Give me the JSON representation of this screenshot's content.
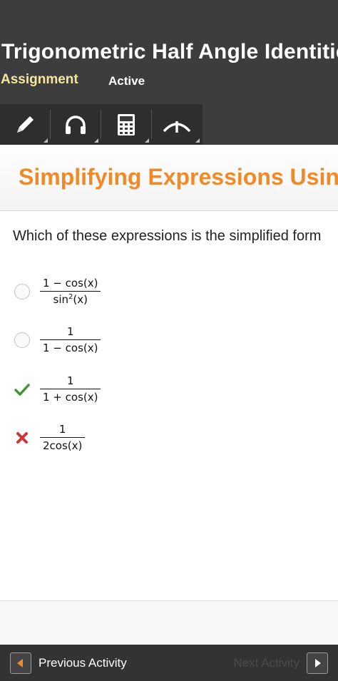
{
  "header": {
    "title": "Trigonometric Half Angle Identitie",
    "subtitle": "Assignment",
    "status": "Active"
  },
  "toolbar": {
    "tools": [
      {
        "icon": "pencil-icon"
      },
      {
        "icon": "headphones-icon"
      },
      {
        "icon": "calculator-icon"
      },
      {
        "icon": "collapse-up-icon"
      }
    ]
  },
  "section": {
    "title": "Simplifying Expressions Usin"
  },
  "question": {
    "text": "Which of these expressions is the simplified form",
    "options": [
      {
        "numerator": "1 − cos(x)",
        "denominator": "sin",
        "denominator_exp": "2",
        "denominator_tail": "(x)",
        "state": "unselected"
      },
      {
        "numerator": "1",
        "denominator": "1 − cos(x)",
        "state": "unselected"
      },
      {
        "numerator": "1",
        "denominator": "1 + cos(x)",
        "state": "correct"
      },
      {
        "numerator": "1",
        "denominator": "2cos(x)",
        "state": "incorrect"
      }
    ]
  },
  "colors": {
    "header_bg": "#3d3d3d",
    "accent_orange": "#ef8a2b",
    "correct_green": "#3f9a2f",
    "incorrect_red": "#d0353a"
  },
  "footer": {
    "prev_label": "Previous Activity",
    "next_label": "Next Activity"
  }
}
